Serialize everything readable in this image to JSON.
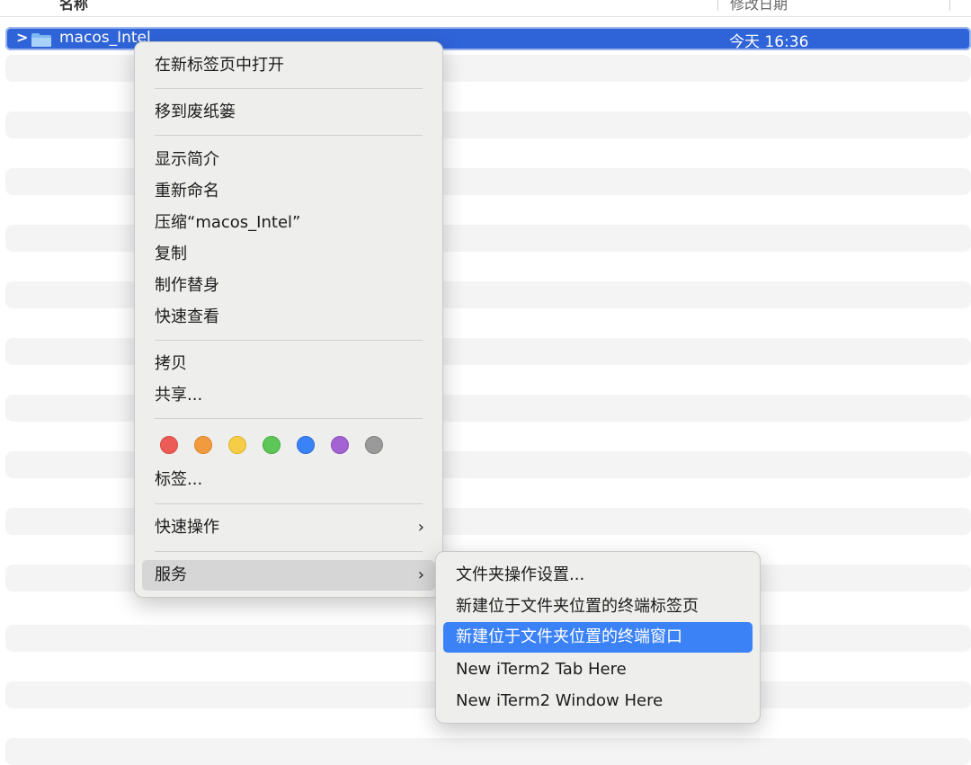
{
  "header": {
    "name_col": "名称",
    "date_col": "修改日期"
  },
  "selected_row": {
    "name": "macos_Intel",
    "date": "今天 16:36",
    "icon": "folder-icon"
  },
  "context_menu": {
    "items": {
      "open_new_tab": "在新标签页中打开",
      "move_to_trash": "移到废纸篓",
      "get_info": "显示简介",
      "rename": "重新命名",
      "compress": "压缩“macos_Intel”",
      "duplicate": "复制",
      "make_alias": "制作替身",
      "quick_look": "快速查看",
      "copy": "拷贝",
      "share": "共享...",
      "tags": "标签...",
      "quick_actions": "快速操作",
      "services": "服务"
    },
    "tag_colors": [
      "#ec5b56",
      "#f19a3e",
      "#f5cd46",
      "#5cc757",
      "#3b82f6",
      "#a463d2",
      "#9a9a9a"
    ],
    "submenu_arrow": "›"
  },
  "services_submenu": {
    "items": [
      "文件夹操作设置...",
      "新建位于文件夹位置的终端标签页",
      "新建位于文件夹位置的终端窗口",
      "New iTerm2 Tab Here",
      "New iTerm2 Window Here"
    ],
    "highlighted_index": 2
  }
}
